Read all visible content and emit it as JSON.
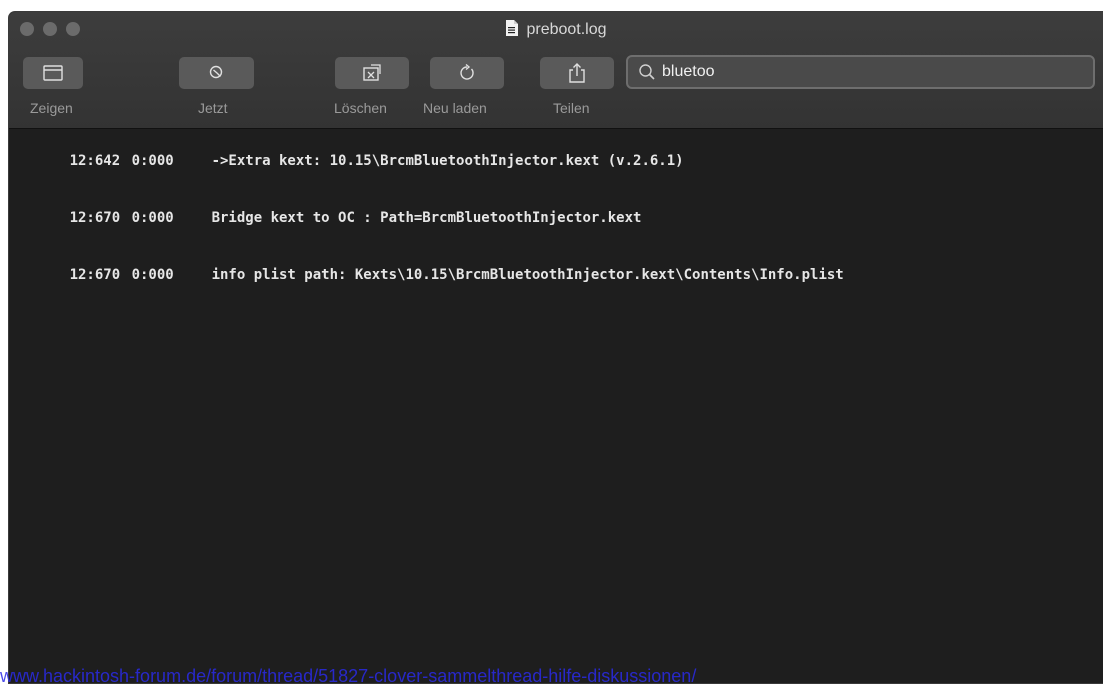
{
  "window": {
    "title": "preboot.log",
    "title_icon": "document-icon"
  },
  "toolbar": {
    "buttons": [
      {
        "icon": "sidebar-icon",
        "label": "Zeigen"
      },
      {
        "icon": "jump-now-icon",
        "label": "Jetzt"
      },
      {
        "icon": "clear-icon",
        "label": "Löschen"
      },
      {
        "icon": "reload-icon",
        "label": "Neu laden"
      },
      {
        "icon": "share-icon",
        "label": "Teilen"
      }
    ]
  },
  "search": {
    "value": "bluetoo",
    "icon": "search-icon"
  },
  "log": [
    {
      "time": "12:642",
      "delta": "0:000",
      "message": "->Extra kext: 10.15\\BrcmBluetoothInjector.kext (v.2.6.1)"
    },
    {
      "time": "12:670",
      "delta": "0:000",
      "message": "Bridge kext to OC : Path=BrcmBluetoothInjector.kext"
    },
    {
      "time": "12:670",
      "delta": "0:000",
      "message": "info plist path: Kexts\\10.15\\BrcmBluetoothInjector.kext\\Contents\\Info.plist"
    }
  ],
  "watermark": "www.hackintosh-forum.de/forum/thread/51827-clover-sammelthread-hilfe-diskussionen/",
  "colors": {
    "background": "#1e1e1e",
    "toolbar": "#3a3a3a",
    "button": "#5a5a5a",
    "text": "#e6e6e6",
    "watermark": "#2a2ae6"
  }
}
